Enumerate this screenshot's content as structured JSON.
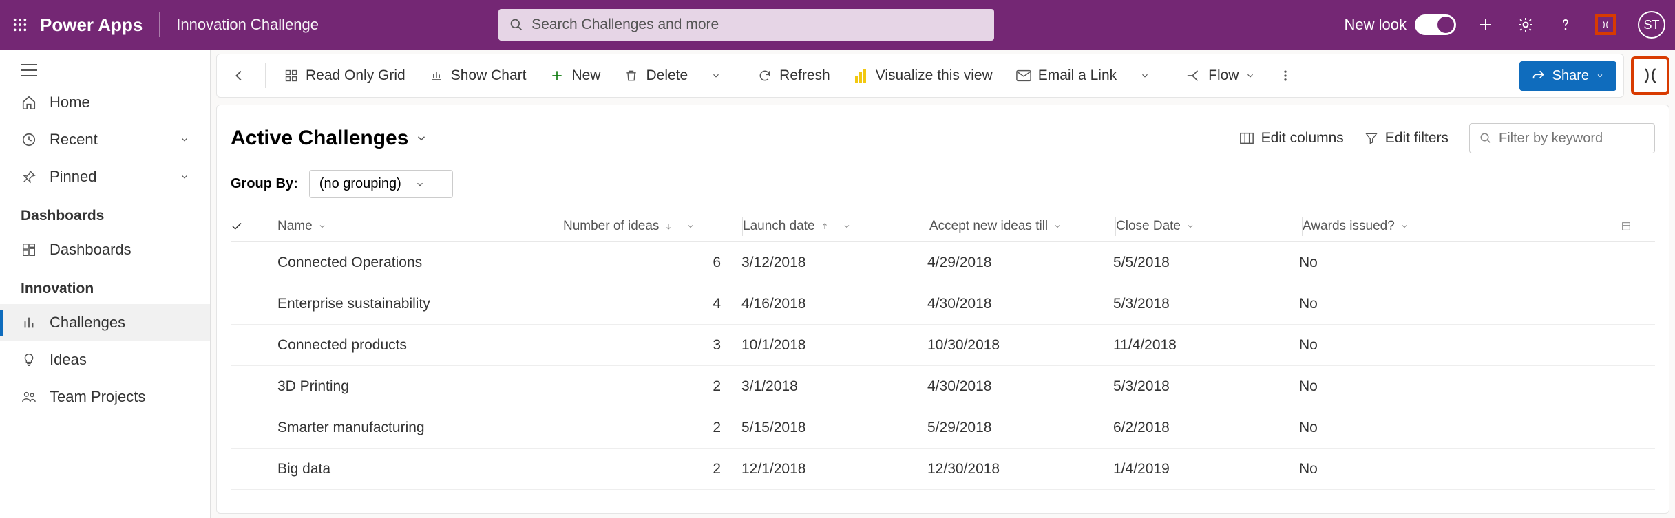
{
  "header": {
    "brand": "Power Apps",
    "app_name": "Innovation Challenge",
    "search_placeholder": "Search Challenges and more",
    "new_look_label": "New look",
    "avatar_initials": "ST"
  },
  "nav": {
    "home": "Home",
    "recent": "Recent",
    "pinned": "Pinned",
    "section_dashboards": "Dashboards",
    "dashboards_item": "Dashboards",
    "section_innovation": "Innovation",
    "challenges": "Challenges",
    "ideas": "Ideas",
    "team_projects": "Team Projects"
  },
  "cmdbar": {
    "read_only_grid": "Read Only Grid",
    "show_chart": "Show Chart",
    "new": "New",
    "delete": "Delete",
    "refresh": "Refresh",
    "visualize": "Visualize this view",
    "email_link": "Email a Link",
    "flow": "Flow",
    "share": "Share"
  },
  "view": {
    "title": "Active Challenges",
    "edit_columns": "Edit columns",
    "edit_filters": "Edit filters",
    "filter_placeholder": "Filter by keyword",
    "group_by_label": "Group By:",
    "group_by_value": "(no grouping)"
  },
  "grid": {
    "columns": {
      "name": "Name",
      "ideas": "Number of ideas",
      "launch": "Launch date",
      "accept": "Accept new ideas till",
      "close": "Close Date",
      "awards": "Awards issued?"
    },
    "rows": [
      {
        "name": "Connected Operations",
        "ideas": "6",
        "launch": "3/12/2018",
        "accept": "4/29/2018",
        "close": "5/5/2018",
        "awards": "No"
      },
      {
        "name": "Enterprise sustainability",
        "ideas": "4",
        "launch": "4/16/2018",
        "accept": "4/30/2018",
        "close": "5/3/2018",
        "awards": "No"
      },
      {
        "name": "Connected products",
        "ideas": "3",
        "launch": "10/1/2018",
        "accept": "10/30/2018",
        "close": "11/4/2018",
        "awards": "No"
      },
      {
        "name": "3D Printing",
        "ideas": "2",
        "launch": "3/1/2018",
        "accept": "4/30/2018",
        "close": "5/3/2018",
        "awards": "No"
      },
      {
        "name": "Smarter manufacturing",
        "ideas": "2",
        "launch": "5/15/2018",
        "accept": "5/29/2018",
        "close": "6/2/2018",
        "awards": "No"
      },
      {
        "name": "Big data",
        "ideas": "2",
        "launch": "12/1/2018",
        "accept": "12/30/2018",
        "close": "1/4/2019",
        "awards": "No"
      }
    ]
  }
}
